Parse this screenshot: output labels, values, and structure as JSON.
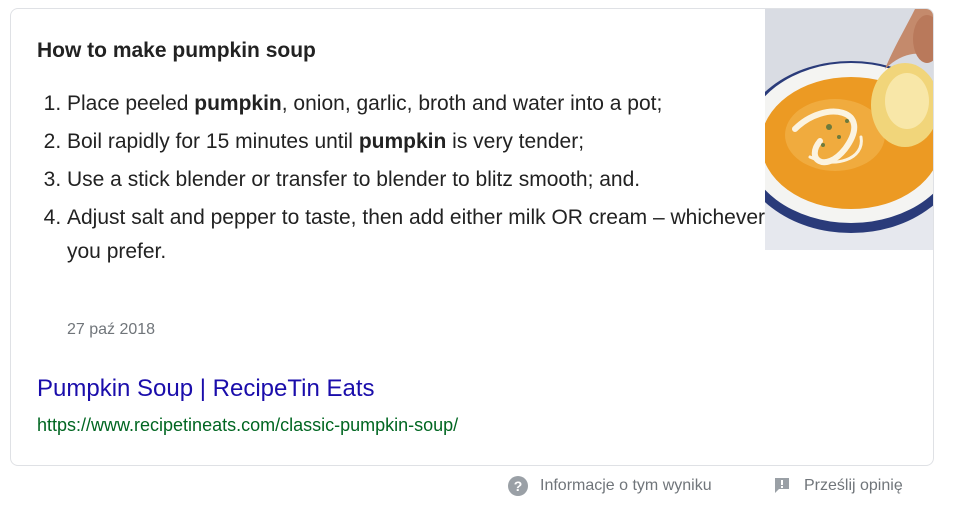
{
  "snippet": {
    "title": "How to make pumpkin soup",
    "steps": [
      {
        "before": "Place peeled ",
        "bold": "pumpkin",
        "after": ", onion, garlic, broth and water into a pot;"
      },
      {
        "before": "Boil rapidly for 15 minutes until ",
        "bold": "pumpkin",
        "after": " is very tender;"
      },
      {
        "before": "Use a stick blender or transfer to blender to blitz smooth; and.",
        "bold": "",
        "after": ""
      },
      {
        "before": "Adjust salt and pepper to taste, then add either milk OR cream – whichever you prefer.",
        "bold": "",
        "after": ""
      }
    ],
    "date": "27 paź 2018",
    "result_title": "Pumpkin Soup | RecipeTin Eats",
    "result_url": "https://www.recipetineats.com/classic-pumpkin-soup/"
  },
  "footer": {
    "about_label": "Informacje o tym wyniku",
    "feedback_label": "Prześlij opinię"
  },
  "icons": {
    "about": "question-circle-icon",
    "feedback": "feedback-flag-icon"
  },
  "colors": {
    "link": "#1a0dab",
    "url": "#006621",
    "muted": "#70757a",
    "soup": "#e8901e"
  }
}
